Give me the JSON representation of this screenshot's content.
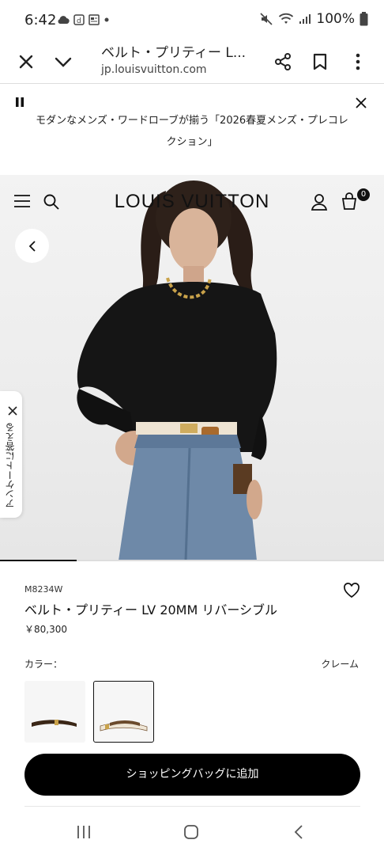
{
  "status_bar": {
    "time": "6:42",
    "battery": "100%"
  },
  "browser": {
    "page_title": "ベルト・プリティー L...",
    "url": "jp.louisvuitton.com"
  },
  "banner": {
    "text": "モダンなメンズ・ワードローブが揃う「2026春夏メンズ・プレコレクション」"
  },
  "header": {
    "logo": "LOUIS VUITTON",
    "bag_count": "0"
  },
  "survey": {
    "label": "アンケートに答える"
  },
  "gallery": {
    "progress_fraction": 0.2
  },
  "product": {
    "sku": "M8234W",
    "name": "ベルト・プリティー LV 20MM リバーシブル",
    "price": "￥80,300",
    "color_label": "カラー：",
    "color_value": "クレーム",
    "add_to_bag": "ショッピングバッグに追加"
  },
  "colors": {
    "accent": "#000000",
    "brown": "#5a3b22",
    "cream": "#efe6d6"
  }
}
